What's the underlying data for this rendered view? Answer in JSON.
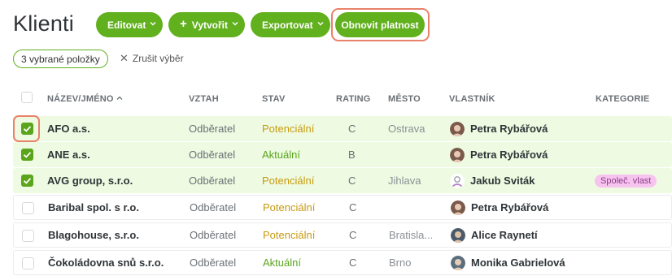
{
  "page": {
    "title": "Klienti"
  },
  "toolbar": {
    "edit_label": "Editovat",
    "create_label": "Vytvořit",
    "export_label": "Exportovat",
    "renew_label": "Obnovit platnost"
  },
  "selection": {
    "badge": "3 vybrané položky",
    "clear_label": "Zrušit výběr"
  },
  "table": {
    "columns": {
      "name": "NÁZEV/JMÉNO",
      "relation": "VZTAH",
      "state": "STAV",
      "rating": "RATING",
      "city": "MĚSTO",
      "owner": "VLASTNÍK",
      "category": "KATEGORIE"
    },
    "sort_icon": "sort-ascending-icon",
    "rows": [
      {
        "name": "AFO a.s.",
        "relation": "Odběratel",
        "state": "Potenciální",
        "rating": "C",
        "city": "Ostrava",
        "owner": "Petra Rybářová",
        "category": "",
        "selected": true
      },
      {
        "name": "ANE a.s.",
        "relation": "Odběratel",
        "state": "Aktuální",
        "rating": "B",
        "city": "",
        "owner": "Petra Rybářová",
        "category": "",
        "selected": true
      },
      {
        "name": "AVG group, s.r.o.",
        "relation": "Odběratel",
        "state": "Potenciální",
        "rating": "C",
        "city": "Jihlava",
        "owner": "Jakub Sviták",
        "category": "Společ. vlast",
        "selected": true
      },
      {
        "name": "Baribal spol. s r.o.",
        "relation": "Odběratel",
        "state": "Potenciální",
        "rating": "C",
        "city": "",
        "owner": "Petra Rybářová",
        "category": "",
        "selected": false
      },
      {
        "name": "Blagohouse, s.r.o.",
        "relation": "Odběratel",
        "state": "Potenciální",
        "rating": "C",
        "city": "Bratisla...",
        "owner": "Alice Raynetí",
        "category": "",
        "selected": false
      },
      {
        "name": "Čokoládovna snů s.r.o.",
        "relation": "Odběratel",
        "state": "Aktuální",
        "rating": "C",
        "city": "Brno",
        "owner": "Monika Gabrielová",
        "category": "",
        "selected": false
      }
    ]
  },
  "colors": {
    "accent": "#61b01d",
    "selected_row": "#eefbe2",
    "highlight": "#e8826a",
    "state_potential": "#c79a10",
    "state_current": "#5aa51c",
    "category_tag": "#f7c4ef"
  }
}
